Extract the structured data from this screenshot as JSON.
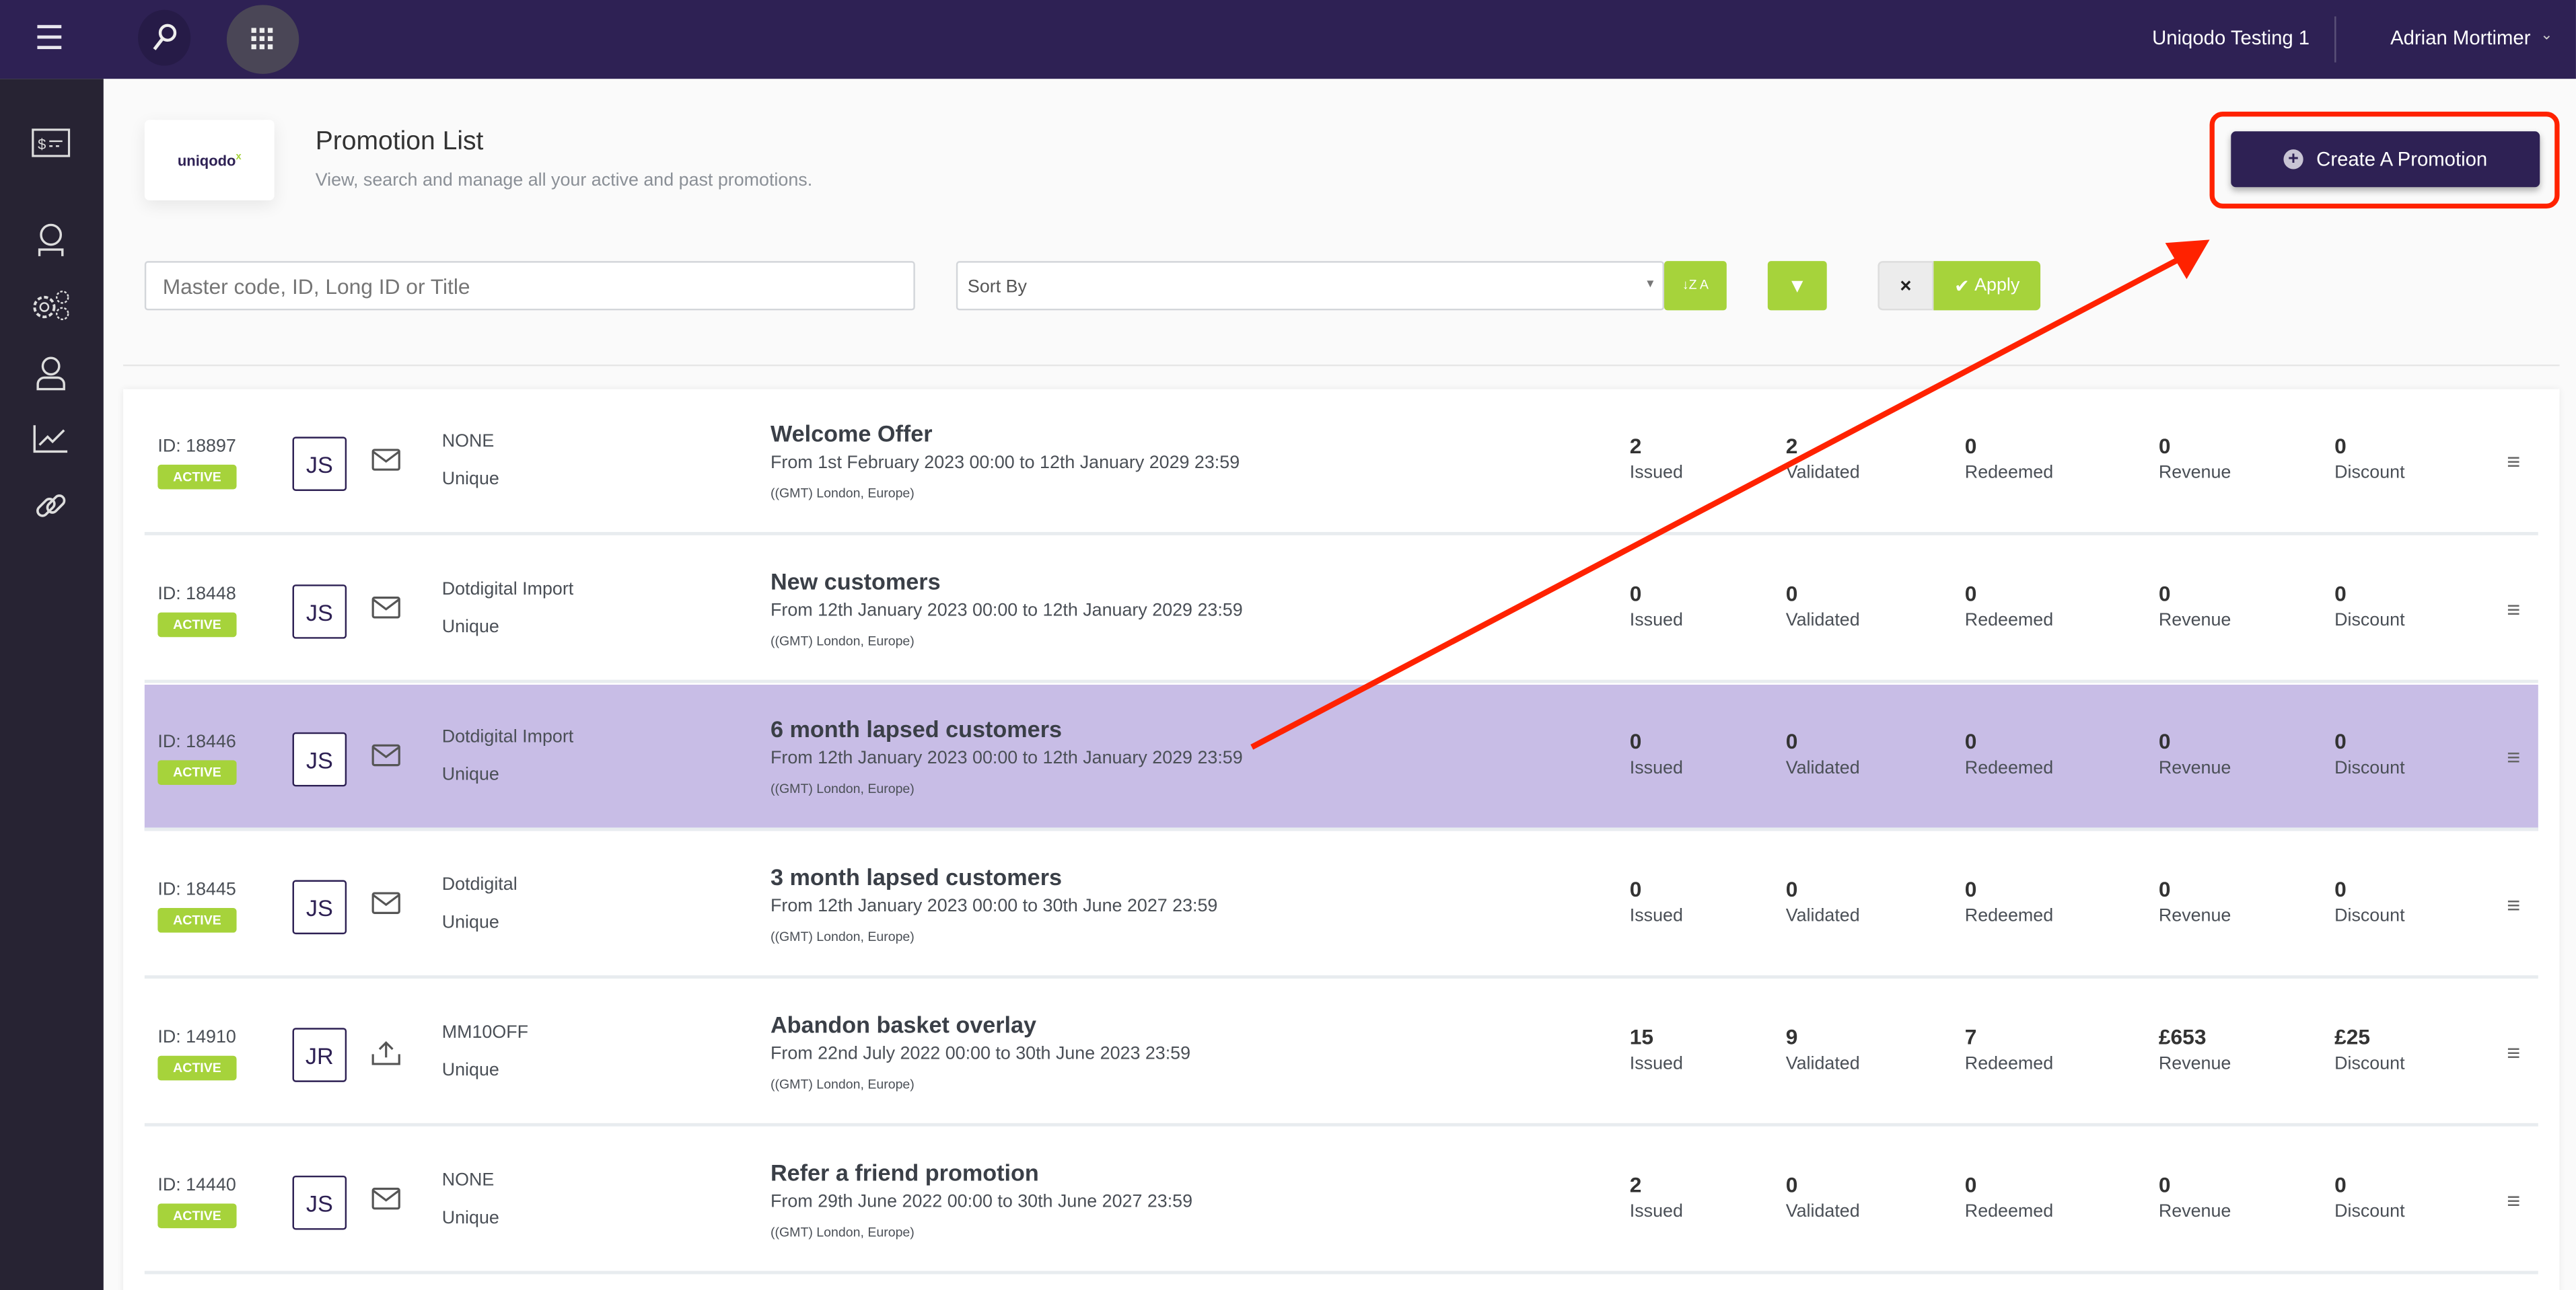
{
  "topbar": {
    "org": "Uniqodo Testing 1",
    "user": "Adrian Mortimer"
  },
  "colors": {
    "brand": "#2e2154",
    "accent": "#a6d33b",
    "highlight_row": "#c8bde6",
    "annotation": "#ff2200"
  },
  "sidebar": {
    "icons": [
      "voucher-icon",
      "support-icon",
      "settings-icon",
      "user-icon",
      "analytics-icon",
      "link-icon"
    ]
  },
  "header": {
    "logo": "uniqodo",
    "title": "Promotion List",
    "subtitle": "View, search and manage all your active and past promotions.",
    "create_label": "Create A Promotion"
  },
  "filters": {
    "search_placeholder": "Master code, ID, Long ID or Title",
    "sort_placeholder": "Sort By",
    "sort_icon_label": "Z A",
    "clear_label": "×",
    "apply_label": "Apply"
  },
  "stat_labels": [
    "Issued",
    "Validated",
    "Redeemed",
    "Revenue",
    "Discount"
  ],
  "promotions": [
    {
      "id": "ID: 18897",
      "status": "ACTIVE",
      "owner": "JS",
      "channel": "email",
      "source": "NONE",
      "type": "Unique",
      "title": "Welcome Offer",
      "dates": "From 1st February 2023 00:00 to 12th January 2029 23:59",
      "tz": "((GMT) London, Europe)",
      "stats": [
        "2",
        "2",
        "0",
        "0",
        "0"
      ]
    },
    {
      "id": "ID: 18448",
      "status": "ACTIVE",
      "owner": "JS",
      "channel": "email",
      "source": "Dotdigital Import",
      "type": "Unique",
      "title": "New customers",
      "dates": "From 12th January 2023 00:00 to 12th January 2029 23:59",
      "tz": "((GMT) London, Europe)",
      "stats": [
        "0",
        "0",
        "0",
        "0",
        "0"
      ]
    },
    {
      "id": "ID: 18446",
      "status": "ACTIVE",
      "owner": "JS",
      "channel": "email",
      "source": "Dotdigital Import",
      "type": "Unique",
      "title": "6 month lapsed customers",
      "dates": "From 12th January 2023 00:00 to 12th January 2029 23:59",
      "tz": "((GMT) London, Europe)",
      "stats": [
        "0",
        "0",
        "0",
        "0",
        "0"
      ]
    },
    {
      "id": "ID: 18445",
      "status": "ACTIVE",
      "owner": "JS",
      "channel": "email",
      "source": "Dotdigital",
      "type": "Unique",
      "title": "3 month lapsed customers",
      "dates": "From 12th January 2023 00:00 to 30th June 2027 23:59",
      "tz": "((GMT) London, Europe)",
      "stats": [
        "0",
        "0",
        "0",
        "0",
        "0"
      ]
    },
    {
      "id": "ID: 14910",
      "status": "ACTIVE",
      "owner": "JR",
      "channel": "upload",
      "source": "MM10OFF",
      "type": "Unique",
      "title": "Abandon basket overlay",
      "dates": "From 22nd July 2022 00:00 to 30th June 2023 23:59",
      "tz": "((GMT) London, Europe)",
      "stats": [
        "15",
        "9",
        "7",
        "£653",
        "£25"
      ]
    },
    {
      "id": "ID: 14440",
      "status": "ACTIVE",
      "owner": "JS",
      "channel": "email",
      "source": "NONE",
      "type": "Unique",
      "title": "Refer a friend promotion",
      "dates": "From 29th June 2022 00:00 to 30th June 2027 23:59",
      "tz": "((GMT) London, Europe)",
      "stats": [
        "2",
        "0",
        "0",
        "0",
        "0"
      ]
    }
  ]
}
